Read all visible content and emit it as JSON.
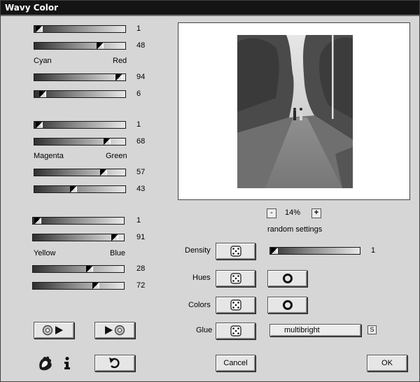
{
  "window": {
    "title": "Wavy Color"
  },
  "groups": [
    {
      "left_label": "Cyan",
      "right_label": "Red",
      "sliders": [
        {
          "value": "1",
          "level": 0.05
        },
        {
          "value": "48",
          "level": 0.72
        },
        {
          "value": "94",
          "level": 0.93
        },
        {
          "value": "6",
          "level": 0.09
        }
      ]
    },
    {
      "left_label": "Magenta",
      "right_label": "Green",
      "sliders": [
        {
          "value": "1",
          "level": 0.05
        },
        {
          "value": "68",
          "level": 0.8
        },
        {
          "value": "57",
          "level": 0.76
        },
        {
          "value": "43",
          "level": 0.43
        }
      ]
    },
    {
      "left_label": "Yellow",
      "right_label": "Blue",
      "sliders": [
        {
          "value": "1",
          "level": 0.05
        },
        {
          "value": "91",
          "level": 0.9
        },
        {
          "value": "28",
          "level": 0.62
        },
        {
          "value": "72",
          "level": 0.69
        }
      ]
    }
  ],
  "zoom": {
    "minus": "-",
    "value": "14%",
    "plus": "+"
  },
  "random_settings_label": "random settings",
  "rows": {
    "density": {
      "label": "Density",
      "value": "1",
      "level": 0.05
    },
    "hues": {
      "label": "Hues"
    },
    "colors": {
      "label": "Colors"
    },
    "glue": {
      "label": "Glue",
      "select_value": "multibright",
      "small_button": "S"
    }
  },
  "buttons": {
    "cancel": "Cancel",
    "ok": "OK"
  }
}
